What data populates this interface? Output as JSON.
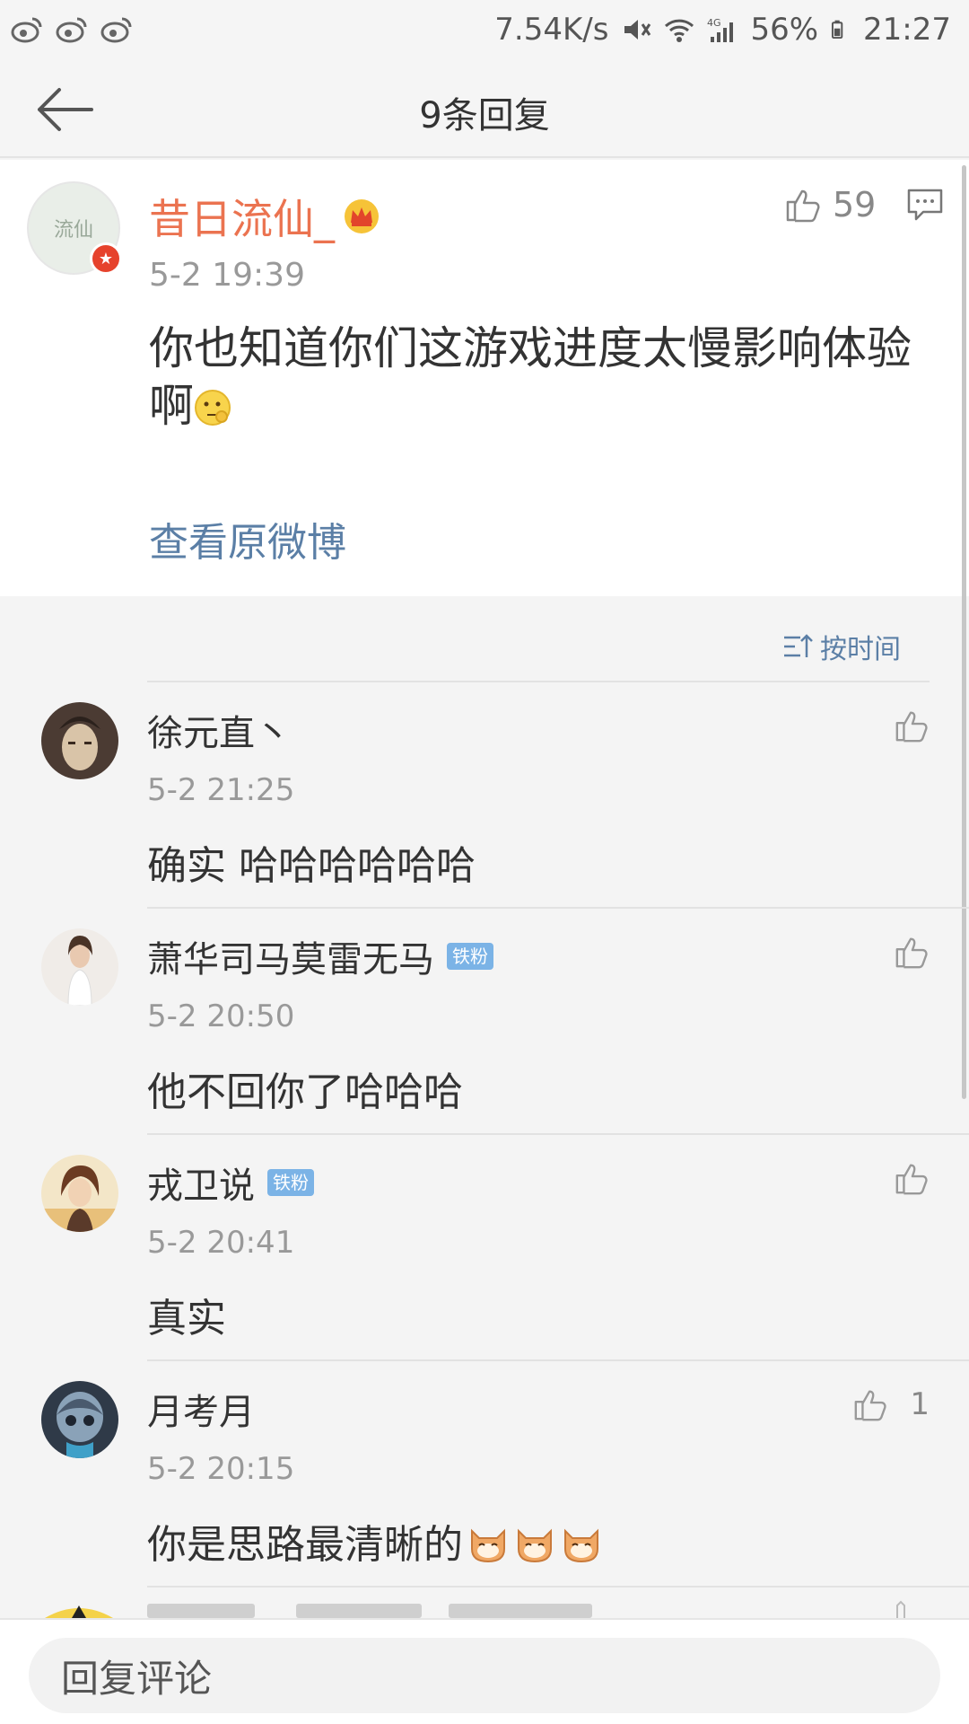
{
  "status_bar": {
    "speed": "7.54K/s",
    "battery": "56%",
    "time": "21:27"
  },
  "nav": {
    "title": "9条回复"
  },
  "main_post": {
    "author": "昔日流仙_",
    "avatar_text": "流仙",
    "time": "5-2 19:39",
    "text": "你也知道你们这游戏进度太慢影响体验啊",
    "likes": "59",
    "view_original": "查看原微博"
  },
  "sort": {
    "label": "按时间"
  },
  "comments": [
    {
      "author": "徐元直丶",
      "badge": "",
      "time": "5-2 21:25",
      "text": "确实 哈哈哈哈哈哈",
      "likes": "",
      "avatar_color": "#5a4a3e"
    },
    {
      "author": "萧华司马莫雷无马",
      "badge": "铁粉",
      "time": "5-2 20:50",
      "text": "他不回你了哈哈哈",
      "likes": "",
      "avatar_color": "#d9d0c8"
    },
    {
      "author": "戎卫说",
      "badge": "铁粉",
      "time": "5-2 20:41",
      "text": "真实",
      "likes": "",
      "avatar_color": "#c7a46a"
    },
    {
      "author": "月考月",
      "badge": "",
      "time": "5-2 20:15",
      "text": "你是思路最清晰的",
      "likes": "1",
      "avatar_color": "#3c4a5a"
    }
  ],
  "reply_bar": {
    "placeholder": "回复评论"
  }
}
